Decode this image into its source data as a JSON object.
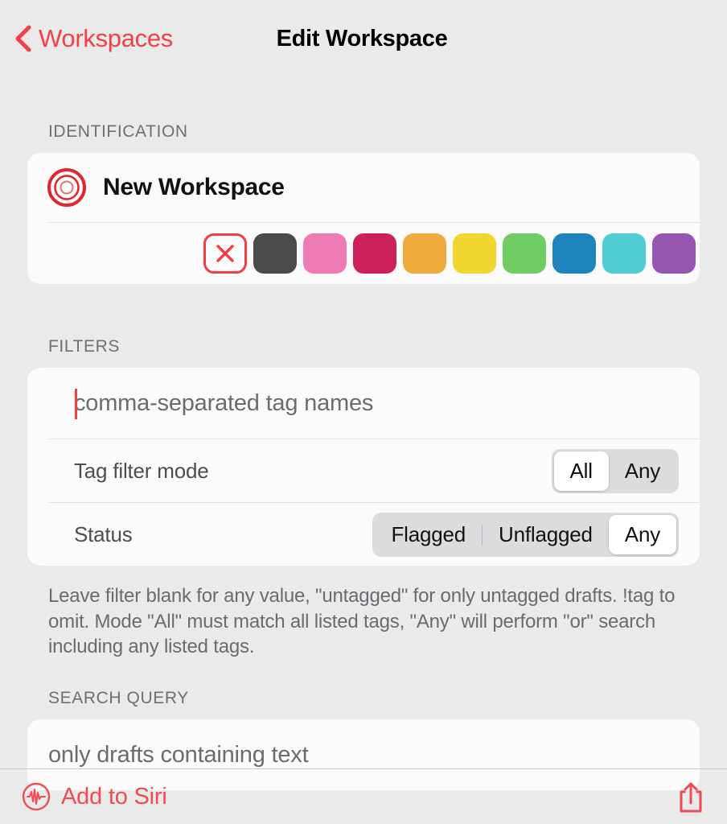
{
  "nav": {
    "back_label": "Workspaces",
    "title": "Edit Workspace",
    "back_icon": "chevron-left-icon",
    "accent_color": "#f04048"
  },
  "identification": {
    "header": "IDENTIFICATION",
    "icon": "target-concentric-circles-icon",
    "workspace_name": "New Workspace",
    "color_swatches": [
      {
        "name": "no-color",
        "icon": "x-icon",
        "color": "none",
        "selected": false
      },
      {
        "name": "dark-gray",
        "color": "#4a4a4a",
        "selected": false
      },
      {
        "name": "pink",
        "color": "#ef7bb4",
        "selected": false
      },
      {
        "name": "crimson",
        "color": "#cc2159",
        "selected": false
      },
      {
        "name": "orange",
        "color": "#f0ab3d",
        "selected": false
      },
      {
        "name": "yellow",
        "color": "#f0d62e",
        "selected": false
      },
      {
        "name": "green",
        "color": "#70cd63",
        "selected": false
      },
      {
        "name": "blue",
        "color": "#1e84bd",
        "selected": false
      },
      {
        "name": "cyan",
        "color": "#52cdd4",
        "selected": false
      },
      {
        "name": "purple",
        "color": "#9656b0",
        "selected": false
      }
    ]
  },
  "filters": {
    "header": "FILTERS",
    "tag_field": {
      "value": "",
      "placeholder": "comma-separated tag names",
      "cursor_visible": true
    },
    "tag_filter_mode": {
      "label": "Tag filter mode",
      "options": [
        "All",
        "Any"
      ],
      "selected": "All"
    },
    "status": {
      "label": "Status",
      "options": [
        "Flagged",
        "Unflagged",
        "Any"
      ],
      "selected": "Any"
    },
    "footnote": "Leave filter blank for any value, \"untagged\" for only untagged drafts. !tag to omit. Mode \"All\" must match all listed tags, \"Any\" will perform \"or\" search including any listed tags."
  },
  "search_query": {
    "header": "SEARCH QUERY",
    "value": "",
    "placeholder": "only drafts containing text"
  },
  "toolbar": {
    "siri_label": "Add to Siri",
    "siri_icon": "siri-waveform-circle-icon",
    "share_icon": "share-upload-icon"
  }
}
